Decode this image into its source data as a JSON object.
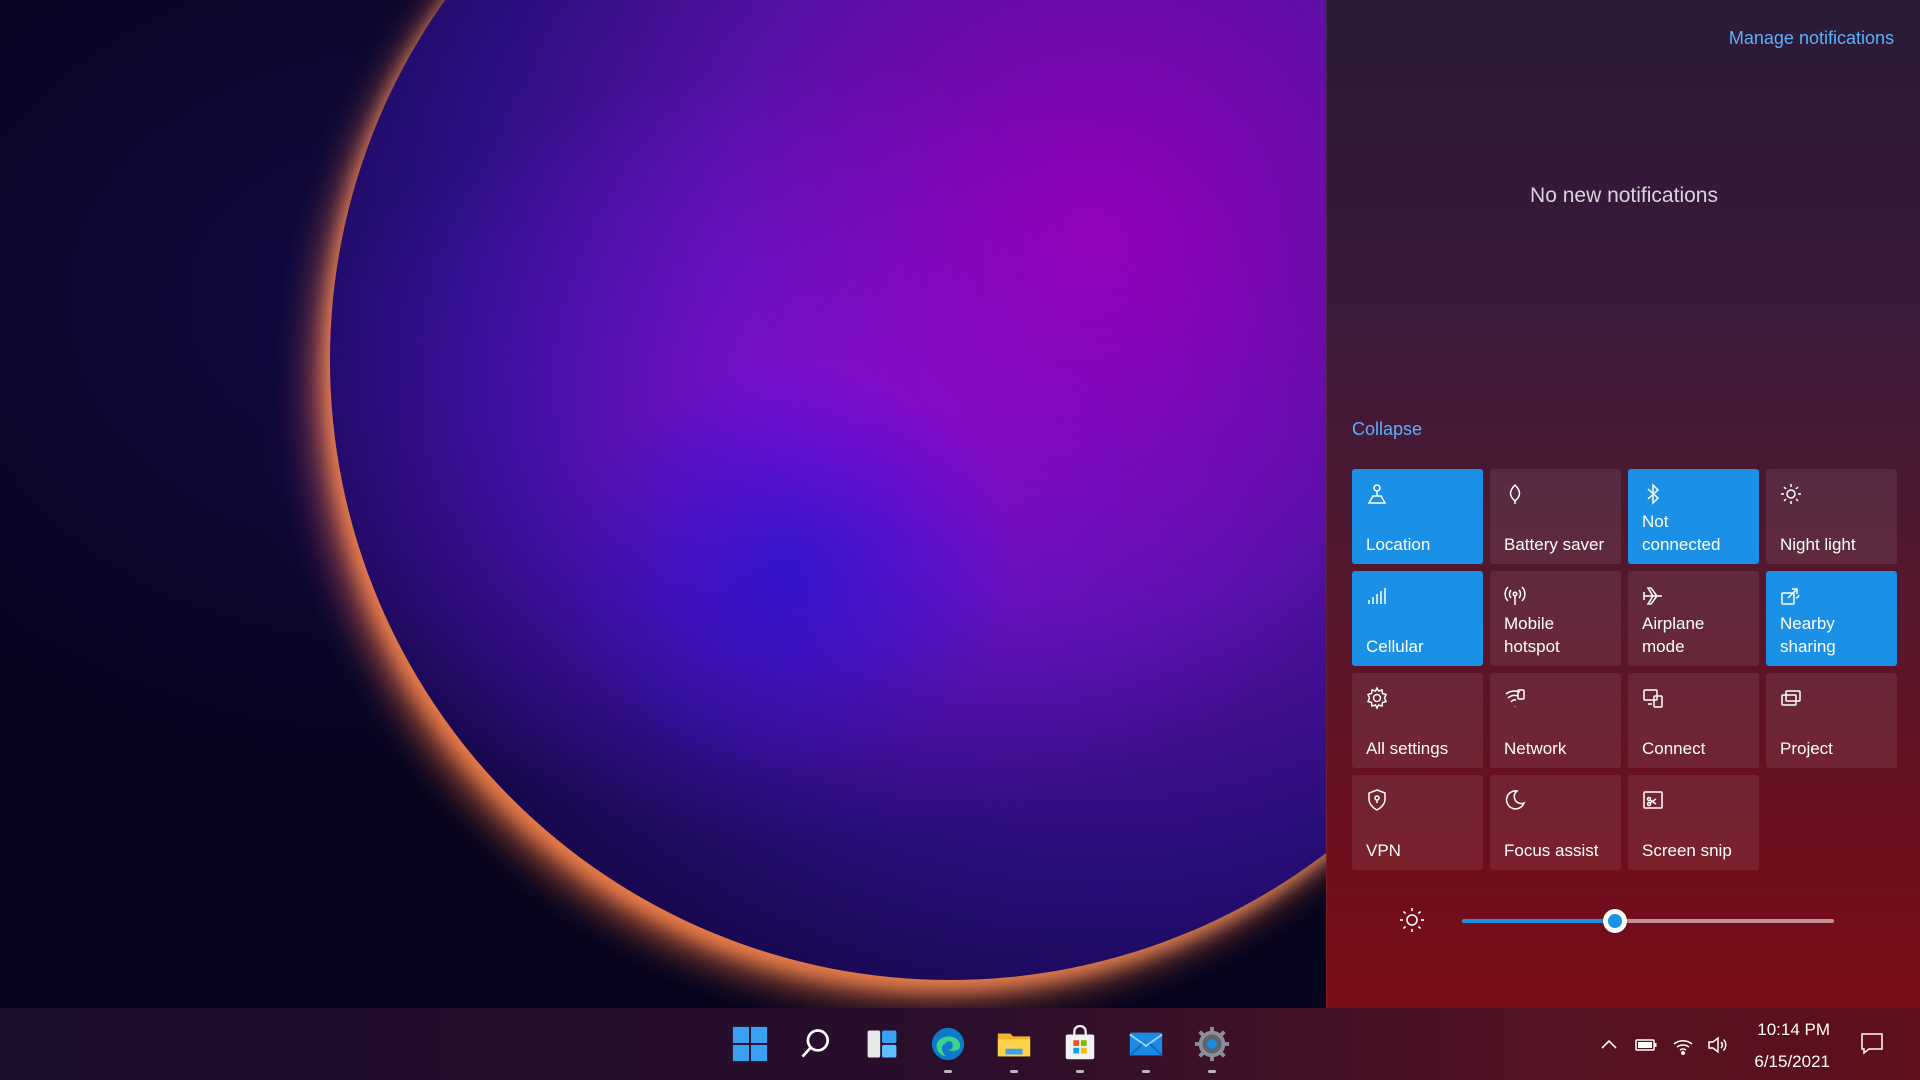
{
  "notification_panel": {
    "manage_link": "Manage notifications",
    "empty_text": "No new notifications",
    "collapse_link": "Collapse"
  },
  "quick_actions": [
    {
      "label": "Location",
      "on": true,
      "icon": "location-icon"
    },
    {
      "label": "Battery saver",
      "on": false,
      "icon": "battery-saver-icon"
    },
    {
      "label": "Not connected",
      "on": true,
      "icon": "bluetooth-icon"
    },
    {
      "label": "Night light",
      "on": false,
      "icon": "night-light-icon"
    },
    {
      "label": "Cellular",
      "on": true,
      "icon": "cellular-icon"
    },
    {
      "label": "Mobile hotspot",
      "on": false,
      "icon": "hotspot-icon"
    },
    {
      "label": "Airplane mode",
      "on": false,
      "icon": "airplane-icon"
    },
    {
      "label": "Nearby sharing",
      "on": true,
      "icon": "nearby-sharing-icon"
    },
    {
      "label": "All settings",
      "on": false,
      "icon": "gear-icon"
    },
    {
      "label": "Network",
      "on": false,
      "icon": "network-icon"
    },
    {
      "label": "Connect",
      "on": false,
      "icon": "connect-icon"
    },
    {
      "label": "Project",
      "on": false,
      "icon": "project-icon"
    },
    {
      "label": "VPN",
      "on": false,
      "icon": "vpn-shield-icon"
    },
    {
      "label": "Focus assist",
      "on": false,
      "icon": "moon-icon"
    },
    {
      "label": "Screen snip",
      "on": false,
      "icon": "screen-snip-icon"
    }
  ],
  "brightness": {
    "level": 0.41,
    "icon": "sun-icon"
  },
  "taskbar": {
    "apps": [
      {
        "name": "start",
        "icon": "windows-logo-icon",
        "running": false
      },
      {
        "name": "search",
        "icon": "search-icon",
        "running": false
      },
      {
        "name": "widgets",
        "icon": "widgets-icon",
        "running": false
      },
      {
        "name": "edge",
        "icon": "edge-browser-icon",
        "running": true
      },
      {
        "name": "file-explorer",
        "icon": "folder-icon",
        "running": true
      },
      {
        "name": "store",
        "icon": "store-icon",
        "running": true
      },
      {
        "name": "mail",
        "icon": "mail-icon",
        "running": true
      },
      {
        "name": "settings",
        "icon": "gear-icon",
        "running": true
      }
    ],
    "tray": [
      "chevron-up-icon",
      "battery-icon",
      "wifi-icon",
      "volume-icon"
    ],
    "time": "10:14 PM",
    "date": "6/15/2021"
  },
  "colors": {
    "accent": "#1a91e6",
    "link": "#5ab0ff"
  }
}
